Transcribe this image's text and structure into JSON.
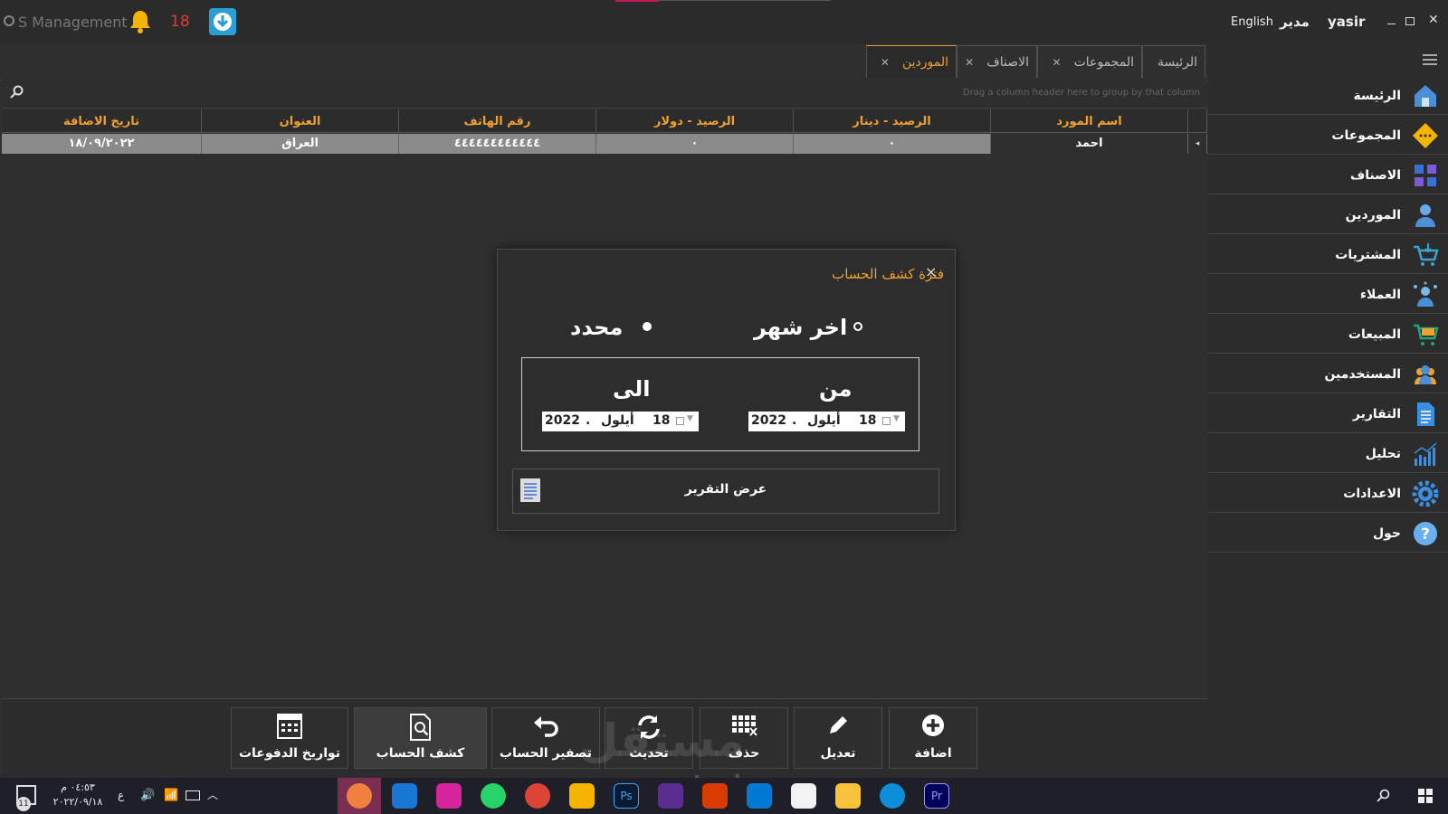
{
  "app": {
    "title": "S Management",
    "notification_count": "18",
    "language_link": "English",
    "user_role": "مدير",
    "user_name": "yasir"
  },
  "tabs": [
    {
      "label": "الرئيسة",
      "closable": false
    },
    {
      "label": "المجموعات",
      "closable": true
    },
    {
      "label": "الاصناف",
      "closable": true
    },
    {
      "label": "الموردين",
      "closable": true,
      "active": true
    }
  ],
  "grid": {
    "group_hint": "Drag a column header here to group by that column",
    "columns": [
      "اسم المورد",
      "الرصيد - دينار",
      "الرصيد - دولار",
      "رقم الهاتف",
      "العنوان",
      "تاريخ الاضافة"
    ],
    "rows": [
      [
        "احمد",
        "٠",
        "٠",
        "٤٤٤٤٤٤٤٤٤٤٤٤",
        "العراق",
        "١٨/٠٩/٢٠٢٢"
      ]
    ]
  },
  "sidebar": {
    "items": [
      {
        "label": "الرئيسة",
        "icon": "home-icon"
      },
      {
        "label": "المجموعات",
        "icon": "groups-icon"
      },
      {
        "label": "الاصناف",
        "icon": "categories-icon"
      },
      {
        "label": "الموردين",
        "icon": "suppliers-icon"
      },
      {
        "label": "المشتريات",
        "icon": "purchases-cart-icon"
      },
      {
        "label": "العملاء",
        "icon": "customers-icon"
      },
      {
        "label": "المبيعات",
        "icon": "sales-cart-icon"
      },
      {
        "label": "المستخدمين",
        "icon": "users-icon"
      },
      {
        "label": "التقارير",
        "icon": "reports-icon"
      },
      {
        "label": "تحليل",
        "icon": "analysis-chart-icon"
      },
      {
        "label": "الاعدادات",
        "icon": "settings-gear-icon"
      },
      {
        "label": "حول",
        "icon": "help-icon"
      }
    ]
  },
  "dialog": {
    "title": "فترة كشف الحساب",
    "close": "×",
    "option_last_month": "اخر شهر",
    "option_specific": "محدد",
    "from_label": "من",
    "to_label": "الى",
    "from_date": {
      "day": "18",
      "month": "أيلول",
      "year": "2022"
    },
    "to_date": {
      "day": "18",
      "month": "أيلول",
      "year": "2022"
    },
    "show_report_button": "عرض التقرير"
  },
  "actions": [
    {
      "label": "اضافة",
      "icon": "add-icon"
    },
    {
      "label": "تعديل",
      "icon": "edit-pencil-icon"
    },
    {
      "label": "حذف",
      "icon": "delete-grid-icon"
    },
    {
      "label": "تحديث",
      "icon": "refresh-icon"
    },
    {
      "label": "تصفير الحساب",
      "icon": "reset-undo-icon"
    },
    {
      "label": "كشف الحساب",
      "icon": "statement-search-icon"
    },
    {
      "label": "تواريخ الدفوعات",
      "icon": "payment-dates-calendar-icon"
    }
  ],
  "taskbar": {
    "time": "٠٤:٥٣ م",
    "date": "٢٠٢٢/٠٩/١٨",
    "lang": "ع",
    "notif_badge": "11"
  },
  "watermark": {
    "text": "مستقل",
    "url": "mostaql.com"
  },
  "colors": {
    "accent": "#f0a030",
    "background": "#2f2f2f",
    "notification": "#e53935"
  }
}
